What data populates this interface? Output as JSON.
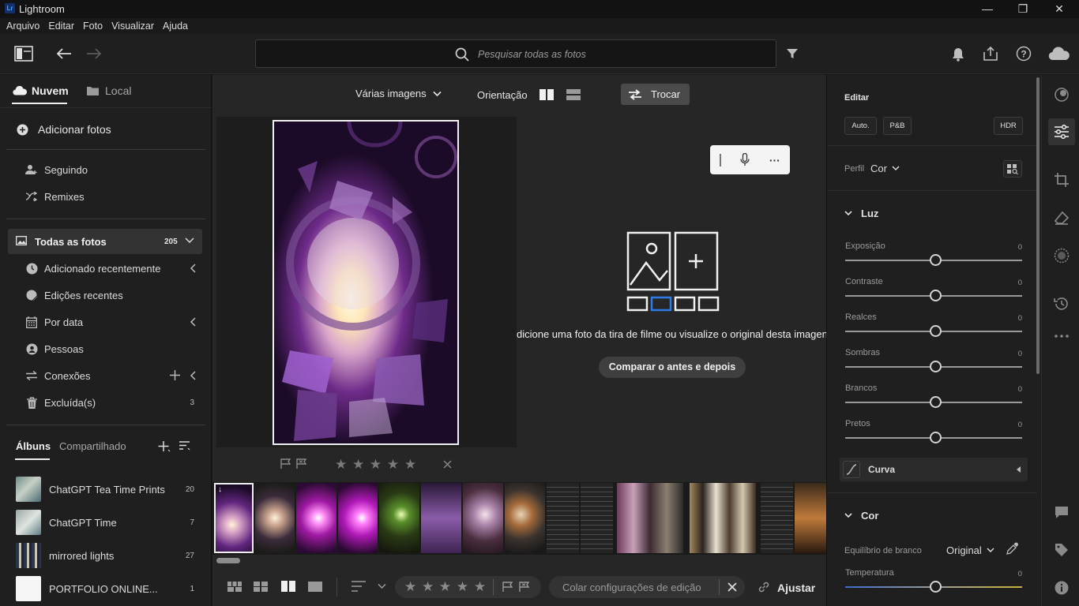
{
  "window": {
    "title": "Lightroom",
    "logo_text": "Lr"
  },
  "menu": [
    "Arquivo",
    "Editar",
    "Foto",
    "Visualizar",
    "Ajuda"
  ],
  "search": {
    "placeholder": "Pesquisar todas as fotos"
  },
  "left": {
    "tabs": {
      "cloud": "Nuvem",
      "local": "Local"
    },
    "add_photos": "Adicionar fotos",
    "following": "Seguindo",
    "remixes": "Remixes",
    "all_photos": {
      "label": "Todas as fotos",
      "count": "205"
    },
    "items": [
      {
        "label": "Adicionado recentemente"
      },
      {
        "label": "Edições recentes"
      },
      {
        "label": "Por data"
      },
      {
        "label": "Pessoas"
      },
      {
        "label": "Conexões"
      },
      {
        "label": "Excluída(s)",
        "count": "3"
      }
    ],
    "album_tabs": {
      "albums": "Álbuns",
      "shared": "Compartilhado"
    },
    "albums": [
      {
        "name": "ChatGPT Tea Time Prints",
        "count": "20"
      },
      {
        "name": "ChatGPT Time",
        "count": "7"
      },
      {
        "name": "mirrored lights",
        "count": "27"
      },
      {
        "name": "PORTFOLIO ONLINE...",
        "count": "1"
      }
    ]
  },
  "center": {
    "multi_images": "Várias imagens",
    "orientation": "Orientação",
    "swap": "Trocar",
    "hint": "dicione uma foto da tira de filme ou visualize o original desta imagen",
    "compare_button": "Comparar o antes e depois",
    "stars": "★ ★ ★ ★ ★",
    "bottom": {
      "paste_settings": "Colar configurações de edição",
      "adjust": "Ajustar"
    }
  },
  "right": {
    "title": "Editar",
    "auto": "Auto.",
    "bw": "P&B",
    "hdr": "HDR",
    "profile_label": "Perfil",
    "profile_value": "Cor",
    "light_section": "Luz",
    "sliders": [
      {
        "label": "Exposição",
        "value": "0"
      },
      {
        "label": "Contraste",
        "value": "0"
      },
      {
        "label": "Realces",
        "value": "0"
      },
      {
        "label": "Sombras",
        "value": "0"
      },
      {
        "label": "Brancos",
        "value": "0"
      },
      {
        "label": "Pretos",
        "value": "0"
      }
    ],
    "curve": "Curva",
    "color_section": "Cor",
    "white_balance_label": "Equilíbrio de branco",
    "white_balance_value": "Original",
    "temperature": {
      "label": "Temperatura",
      "value": "0"
    }
  },
  "colors": {
    "accent_blue": "#2d7be5",
    "panel": "#1f1f1f",
    "canvas": "#262626"
  }
}
